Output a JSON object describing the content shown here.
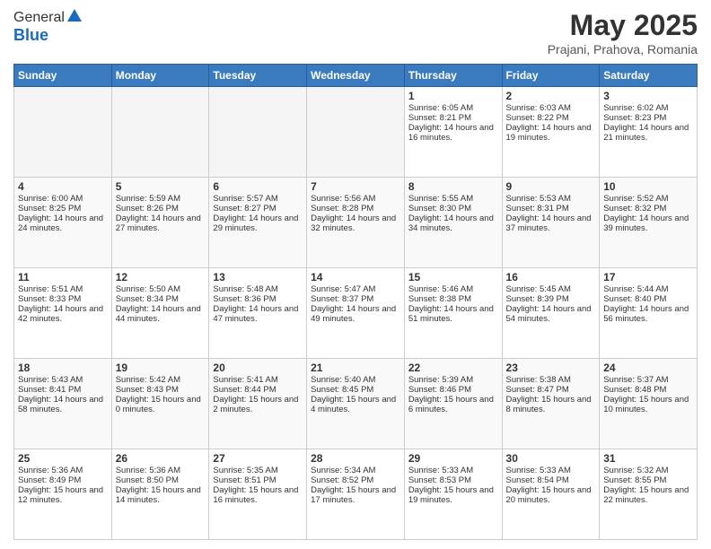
{
  "header": {
    "logo": {
      "general": "General",
      "blue": "Blue"
    },
    "title": "May 2025",
    "location": "Prajani, Prahova, Romania"
  },
  "weekdays": [
    "Sunday",
    "Monday",
    "Tuesday",
    "Wednesday",
    "Thursday",
    "Friday",
    "Saturday"
  ],
  "weeks": [
    [
      {
        "day": "",
        "empty": true
      },
      {
        "day": "",
        "empty": true
      },
      {
        "day": "",
        "empty": true
      },
      {
        "day": "",
        "empty": true
      },
      {
        "day": "1",
        "sunrise": "6:05 AM",
        "sunset": "8:21 PM",
        "daylight": "14 hours and 16 minutes."
      },
      {
        "day": "2",
        "sunrise": "6:03 AM",
        "sunset": "8:22 PM",
        "daylight": "14 hours and 19 minutes."
      },
      {
        "day": "3",
        "sunrise": "6:02 AM",
        "sunset": "8:23 PM",
        "daylight": "14 hours and 21 minutes."
      }
    ],
    [
      {
        "day": "4",
        "sunrise": "6:00 AM",
        "sunset": "8:25 PM",
        "daylight": "14 hours and 24 minutes."
      },
      {
        "day": "5",
        "sunrise": "5:59 AM",
        "sunset": "8:26 PM",
        "daylight": "14 hours and 27 minutes."
      },
      {
        "day": "6",
        "sunrise": "5:57 AM",
        "sunset": "8:27 PM",
        "daylight": "14 hours and 29 minutes."
      },
      {
        "day": "7",
        "sunrise": "5:56 AM",
        "sunset": "8:28 PM",
        "daylight": "14 hours and 32 minutes."
      },
      {
        "day": "8",
        "sunrise": "5:55 AM",
        "sunset": "8:30 PM",
        "daylight": "14 hours and 34 minutes."
      },
      {
        "day": "9",
        "sunrise": "5:53 AM",
        "sunset": "8:31 PM",
        "daylight": "14 hours and 37 minutes."
      },
      {
        "day": "10",
        "sunrise": "5:52 AM",
        "sunset": "8:32 PM",
        "daylight": "14 hours and 39 minutes."
      }
    ],
    [
      {
        "day": "11",
        "sunrise": "5:51 AM",
        "sunset": "8:33 PM",
        "daylight": "14 hours and 42 minutes."
      },
      {
        "day": "12",
        "sunrise": "5:50 AM",
        "sunset": "8:34 PM",
        "daylight": "14 hours and 44 minutes."
      },
      {
        "day": "13",
        "sunrise": "5:48 AM",
        "sunset": "8:36 PM",
        "daylight": "14 hours and 47 minutes."
      },
      {
        "day": "14",
        "sunrise": "5:47 AM",
        "sunset": "8:37 PM",
        "daylight": "14 hours and 49 minutes."
      },
      {
        "day": "15",
        "sunrise": "5:46 AM",
        "sunset": "8:38 PM",
        "daylight": "14 hours and 51 minutes."
      },
      {
        "day": "16",
        "sunrise": "5:45 AM",
        "sunset": "8:39 PM",
        "daylight": "14 hours and 54 minutes."
      },
      {
        "day": "17",
        "sunrise": "5:44 AM",
        "sunset": "8:40 PM",
        "daylight": "14 hours and 56 minutes."
      }
    ],
    [
      {
        "day": "18",
        "sunrise": "5:43 AM",
        "sunset": "8:41 PM",
        "daylight": "14 hours and 58 minutes."
      },
      {
        "day": "19",
        "sunrise": "5:42 AM",
        "sunset": "8:43 PM",
        "daylight": "15 hours and 0 minutes."
      },
      {
        "day": "20",
        "sunrise": "5:41 AM",
        "sunset": "8:44 PM",
        "daylight": "15 hours and 2 minutes."
      },
      {
        "day": "21",
        "sunrise": "5:40 AM",
        "sunset": "8:45 PM",
        "daylight": "15 hours and 4 minutes."
      },
      {
        "day": "22",
        "sunrise": "5:39 AM",
        "sunset": "8:46 PM",
        "daylight": "15 hours and 6 minutes."
      },
      {
        "day": "23",
        "sunrise": "5:38 AM",
        "sunset": "8:47 PM",
        "daylight": "15 hours and 8 minutes."
      },
      {
        "day": "24",
        "sunrise": "5:37 AM",
        "sunset": "8:48 PM",
        "daylight": "15 hours and 10 minutes."
      }
    ],
    [
      {
        "day": "25",
        "sunrise": "5:36 AM",
        "sunset": "8:49 PM",
        "daylight": "15 hours and 12 minutes."
      },
      {
        "day": "26",
        "sunrise": "5:36 AM",
        "sunset": "8:50 PM",
        "daylight": "15 hours and 14 minutes."
      },
      {
        "day": "27",
        "sunrise": "5:35 AM",
        "sunset": "8:51 PM",
        "daylight": "15 hours and 16 minutes."
      },
      {
        "day": "28",
        "sunrise": "5:34 AM",
        "sunset": "8:52 PM",
        "daylight": "15 hours and 17 minutes."
      },
      {
        "day": "29",
        "sunrise": "5:33 AM",
        "sunset": "8:53 PM",
        "daylight": "15 hours and 19 minutes."
      },
      {
        "day": "30",
        "sunrise": "5:33 AM",
        "sunset": "8:54 PM",
        "daylight": "15 hours and 20 minutes."
      },
      {
        "day": "31",
        "sunrise": "5:32 AM",
        "sunset": "8:55 PM",
        "daylight": "15 hours and 22 minutes."
      }
    ]
  ],
  "labels": {
    "sunrise": "Sunrise:",
    "sunset": "Sunset:",
    "daylight": "Daylight:"
  }
}
